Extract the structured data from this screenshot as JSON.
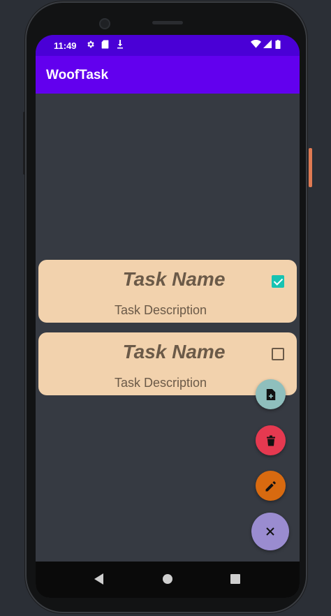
{
  "status_bar": {
    "time": "11:49",
    "left_icons": [
      "settings-gear-icon",
      "sd-card-icon",
      "download-icon"
    ],
    "right_icons": [
      "wifi-icon",
      "signal-icon",
      "battery-icon"
    ]
  },
  "app_bar": {
    "title": "WoofTask"
  },
  "tasks": [
    {
      "name": "Task Name",
      "description": "Task Description",
      "checked": true
    },
    {
      "name": "Task Name",
      "description": "Task Description",
      "checked": false
    }
  ],
  "fabs": [
    {
      "name": "add-task-fab",
      "icon": "note-add-icon",
      "color": "#8fbfbd"
    },
    {
      "name": "delete-fab",
      "icon": "trash-icon",
      "color": "#e53950"
    },
    {
      "name": "edit-fab",
      "icon": "pencil-icon",
      "color": "#d86a10"
    },
    {
      "name": "close-fab",
      "icon": "close-icon",
      "color": "#9a8cd0"
    }
  ],
  "colors": {
    "status_bar": "#4a00d6",
    "app_bar": "#6200ee",
    "background": "#363a42",
    "card": "#f2d2ad",
    "card_text": "#6b5a48",
    "checkbox_checked": "#17c3b2"
  },
  "nav_bar": {
    "buttons": [
      "back-icon",
      "home-icon",
      "recents-icon"
    ]
  }
}
